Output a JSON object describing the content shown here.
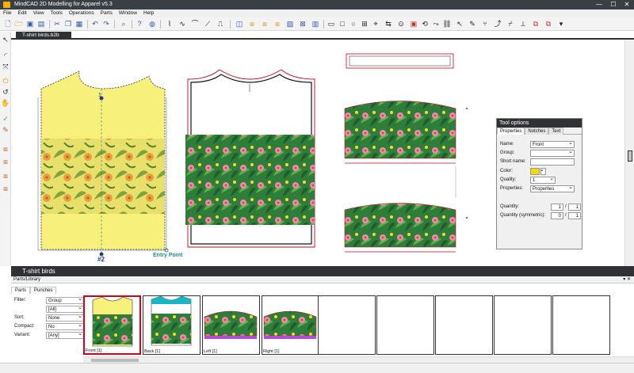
{
  "app": {
    "title": "MindCAD 2D Modelling for Apparel v5.3",
    "window_controls": [
      "—",
      "☐",
      "✕"
    ]
  },
  "menu": [
    "File",
    "Edit",
    "View",
    "Tools",
    "Operations",
    "Parts",
    "Window",
    "Help"
  ],
  "document_tab": "T-shirt birds.b2b",
  "canvas": {
    "piece_labels": {
      "marker_number": "#2",
      "marker_top": "1",
      "entry_point": "Entry Point"
    }
  },
  "tool_options": {
    "title": "Tool options",
    "tabs": [
      "Properties",
      "Notches",
      "Text"
    ],
    "active_tab": "Properties",
    "fields": {
      "name_label": "Name:",
      "name_value": "Front",
      "group_label": "Group:",
      "group_value": "",
      "short_name_label": "Short name:",
      "short_name_value": "",
      "color_label": "Color:",
      "color_value": "#f5d800",
      "quality_label": "Quality:",
      "quality_value": "1",
      "properties_label": "Properties:",
      "properties_value": "Properties",
      "quantity_label": "Quantity:",
      "quantity_a": "1",
      "quantity_b": "1",
      "quantity_sym_label": "Quantity (symmetric):",
      "quantity_sym_a": "0",
      "quantity_sym_b": "1",
      "slash": "/"
    }
  },
  "panel_title": "T-shirt birds",
  "library": {
    "header": "Parts/Library",
    "tabs": [
      "Parts",
      "Punches"
    ],
    "filters": [
      {
        "label": "Filter:",
        "value": "Group"
      },
      {
        "label": "",
        "value": "[All]"
      },
      {
        "label": "Sort:",
        "value": "None"
      },
      {
        "label": "Compact:",
        "value": "No"
      },
      {
        "label": "Variant:",
        "value": "[Any]"
      }
    ],
    "thumbnails": [
      {
        "label": "Front [1]",
        "selected": true,
        "kind": "front"
      },
      {
        "label": "Back [1]",
        "selected": false,
        "kind": "back"
      },
      {
        "label": "Left [1]",
        "selected": false,
        "kind": "sleeve"
      },
      {
        "label": "Right [1]",
        "selected": false,
        "kind": "sleeve"
      },
      {
        "label": "",
        "selected": false,
        "kind": "empty"
      },
      {
        "label": "",
        "selected": false,
        "kind": "empty"
      },
      {
        "label": "",
        "selected": false,
        "kind": "empty"
      },
      {
        "label": "",
        "selected": false,
        "kind": "empty"
      },
      {
        "label": "",
        "selected": false,
        "kind": "empty"
      }
    ]
  },
  "colors": {
    "accent": "#d6001c",
    "yellow_piece": "#f7f07a",
    "dark_header": "#2f3235",
    "toolbar_icon": "#2a5ba8"
  }
}
